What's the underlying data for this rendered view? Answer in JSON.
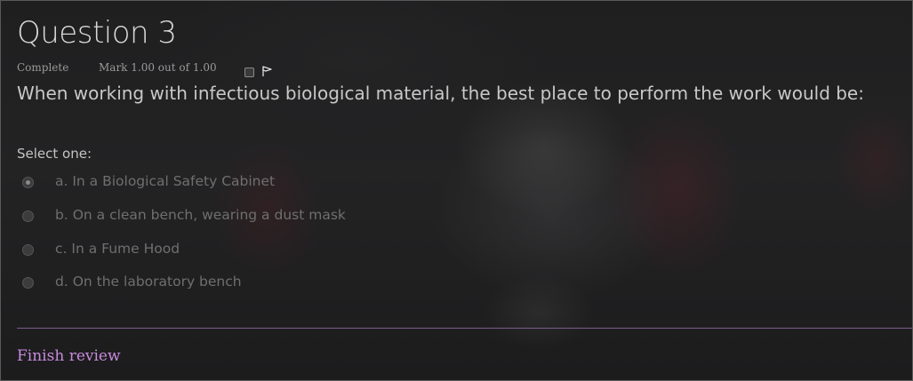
{
  "question": {
    "title": "Question 3",
    "state": "Complete",
    "grade": "Mark 1.00 out of 1.00",
    "text": "When working with infectious biological material, the best place to perform the work would be:",
    "prompt": "Select one:"
  },
  "answers": [
    {
      "label": "a. In a Biological Safety Cabinet",
      "selected": true
    },
    {
      "label": "b. On a clean bench, wearing a dust mask",
      "selected": false
    },
    {
      "label": "c. In a Fume Hood",
      "selected": false
    },
    {
      "label": "d. On the laboratory bench",
      "selected": false
    }
  ],
  "footer": {
    "finish_link": "Finish review"
  },
  "icons": {
    "flag": "flag-icon",
    "flag_checkbox": "checkbox"
  },
  "colors": {
    "link": "#c98bdd",
    "divider": "#7a5c8c"
  }
}
